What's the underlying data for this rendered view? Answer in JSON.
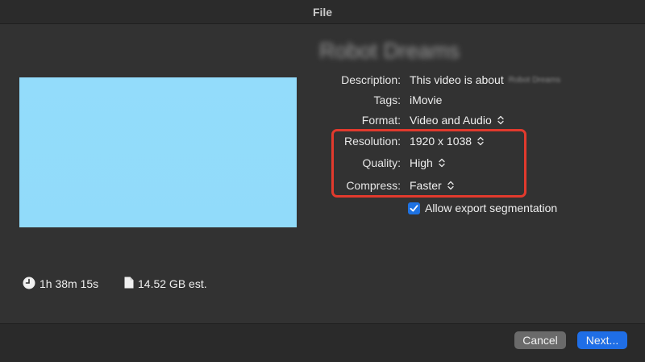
{
  "window": {
    "title": "File"
  },
  "movie": {
    "title": "Robot Dreams"
  },
  "details": {
    "description_label": "Description:",
    "description_value": "This video is about",
    "description_blurred": "Robot Dreams",
    "tags_label": "Tags:",
    "tags_value": "iMovie",
    "format_label": "Format:",
    "format_value": "Video and Audio",
    "resolution_label": "Resolution:",
    "resolution_value": "1920 x 1038",
    "quality_label": "Quality:",
    "quality_value": "High",
    "compress_label": "Compress:",
    "compress_value": "Faster"
  },
  "options": {
    "allow_segmentation_label": "Allow export segmentation",
    "allow_segmentation_checked": true
  },
  "stats": {
    "duration": "1h 38m 15s",
    "size": "14.52 GB est."
  },
  "buttons": {
    "cancel": "Cancel",
    "next": "Next..."
  },
  "colors": {
    "accent": "#1f6ee6",
    "highlight": "#e23a2d",
    "preview": "#93dcfb"
  },
  "icons": [
    "clock-icon",
    "document-icon",
    "checkmark-icon",
    "updown-chevron-icon"
  ]
}
